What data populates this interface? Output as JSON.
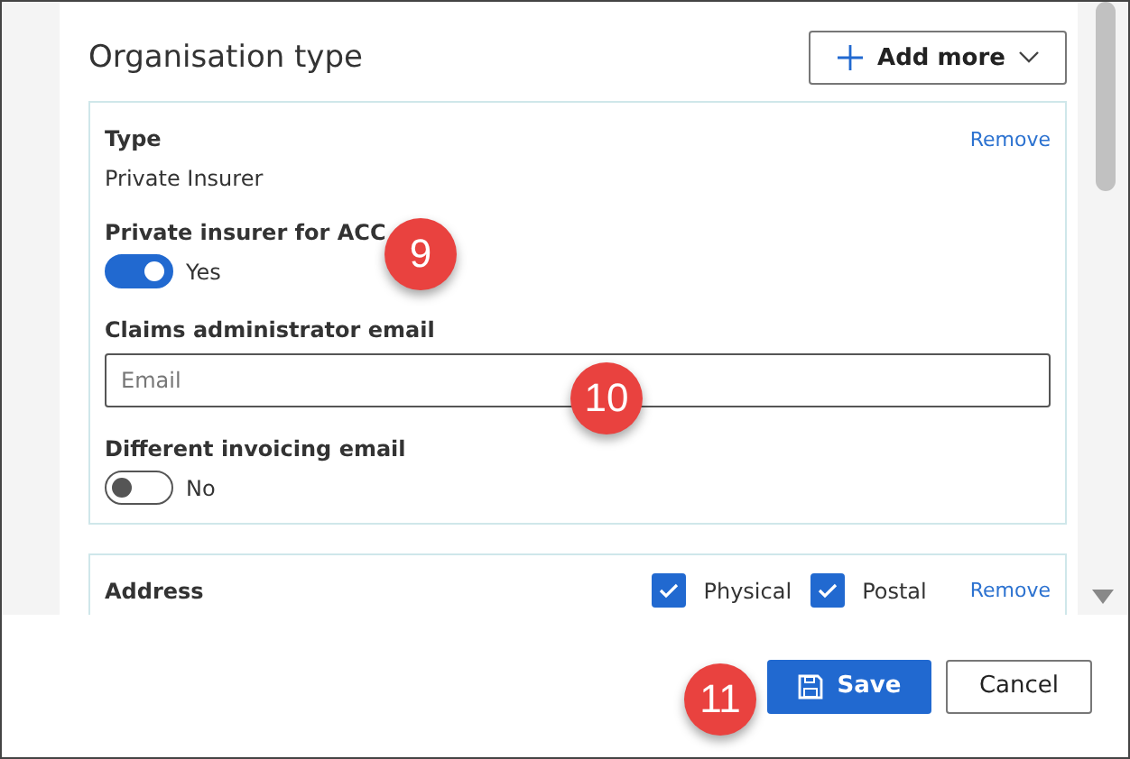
{
  "section": {
    "title": "Organisation type",
    "add_button": "Add more"
  },
  "type_card": {
    "type_label": "Type",
    "remove": "Remove",
    "type_value": "Private Insurer",
    "fields": [
      {
        "kind": "toggle",
        "label": "Private insurer for ACC",
        "on": true,
        "state_text": "Yes"
      },
      {
        "kind": "input",
        "label": "Claims administrator email",
        "placeholder": "Email"
      },
      {
        "kind": "toggle",
        "label": "Different invoicing email",
        "on": false,
        "state_text": "No"
      }
    ]
  },
  "address_card": {
    "label": "Address",
    "options": [
      {
        "label": "Physical",
        "checked": true
      },
      {
        "label": "Postal",
        "checked": true
      }
    ],
    "remove": "Remove"
  },
  "callouts": [
    "9",
    "10",
    "11"
  ],
  "footer": {
    "save": "Save",
    "cancel": "Cancel"
  }
}
